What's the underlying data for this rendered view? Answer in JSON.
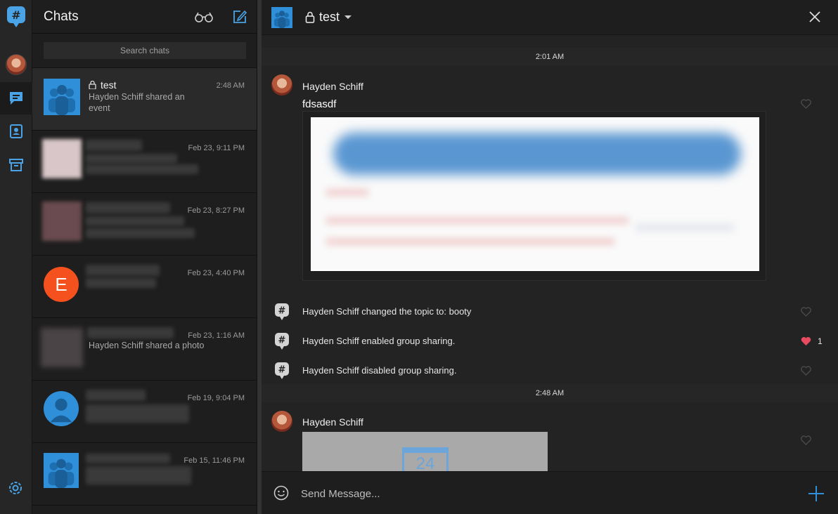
{
  "list": {
    "title": "Chats",
    "search_placeholder": "Search chats",
    "chats": [
      {
        "name": "test",
        "preview": "Hayden Schiff shared an event",
        "time": "2:48 AM"
      },
      {
        "name": "",
        "preview": "",
        "time": "Feb 23, 9:11 PM"
      },
      {
        "name": "",
        "preview": "",
        "time": "Feb 23, 8:27 PM"
      },
      {
        "name": "",
        "preview": "",
        "time": "Feb 23, 4:40 PM",
        "avatar_letter": "E"
      },
      {
        "name": "",
        "preview": "Hayden Schiff shared a photo",
        "time": "Feb 23, 1:16 AM"
      },
      {
        "name": "",
        "preview": "",
        "time": "Feb 19, 9:04 PM"
      },
      {
        "name": "",
        "preview": "",
        "time": "Feb 15, 11:46 PM"
      }
    ]
  },
  "conversation": {
    "title": "test",
    "messages": {
      "sep1": "2:01 AM",
      "sender1": "Hayden Schiff",
      "text1": "fdsasdf",
      "sys1": "Hayden Schiff changed the topic to: booty",
      "sys2": "Hayden Schiff enabled group sharing.",
      "sys2_likes": "1",
      "sys3": "Hayden Schiff disabled group sharing.",
      "sep2": "2:48 AM",
      "sender2": "Hayden Schiff",
      "calendar_day": "24"
    },
    "composer_placeholder": "Send Message..."
  },
  "colors": {
    "accent_blue": "#2f8fd8",
    "orange_avatar": "#f4511e",
    "heart_active": "#e84a5f"
  }
}
